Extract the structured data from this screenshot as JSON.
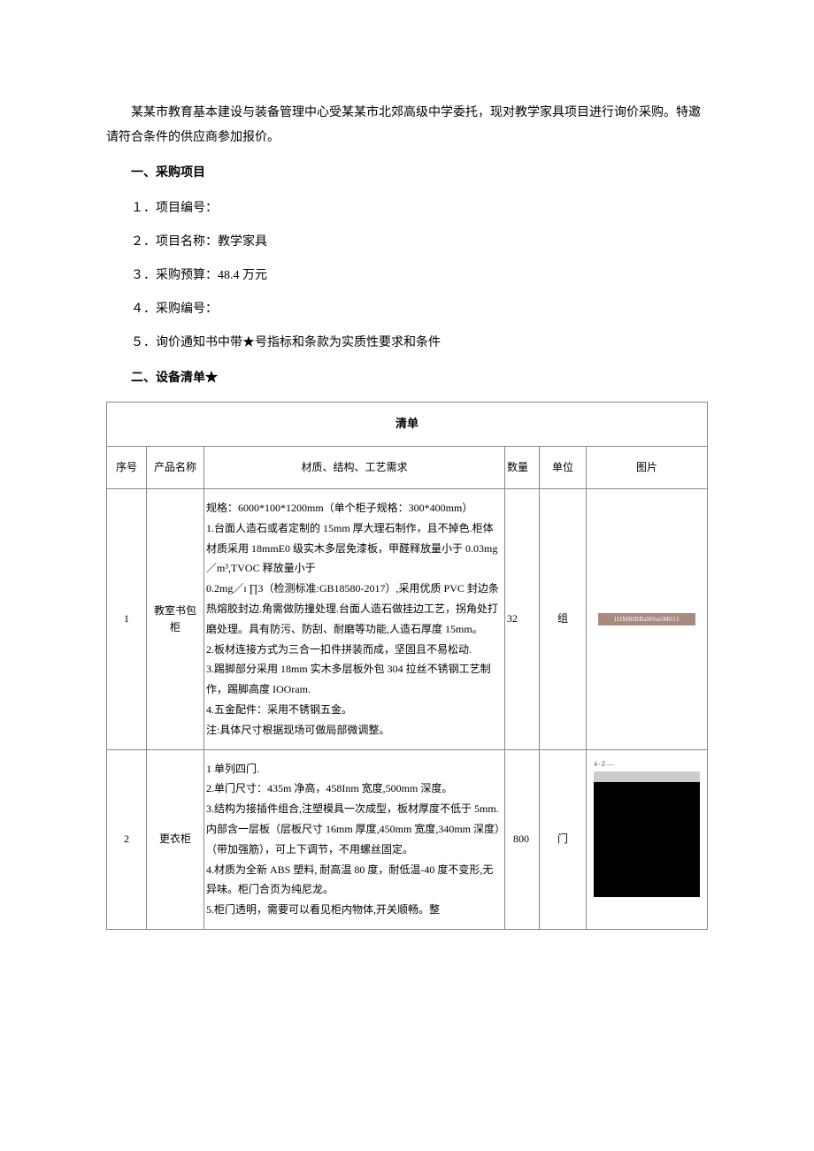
{
  "intro": "某某市教育基本建设与装备管理中心受某某市北郊高级中学委托，现对教学家具项目进行询价采购。特邀请符合条件的供应商参加报价。",
  "section1_title": "一、采购项目",
  "item1": "１．项目编号：",
  "item2": "２．项目名称：教学家具",
  "item3": "３．采购预算：48.4 万元",
  "item4": "４．采购编号：",
  "item5": "５．询价通知书中带★号指标和条款为实质性要求和条件",
  "section2_title": "二、设备清单★",
  "table": {
    "caption": "清单",
    "headers": {
      "seq": "序号",
      "name": "产品名称",
      "spec": "材质、结构、工艺需求",
      "qty": "数量",
      "unit": "单位",
      "img": "图片"
    },
    "rows": [
      {
        "seq": "1",
        "name": "教室书包柜",
        "spec": "规格：6000*100*1200mm（单个柜子规格：300*400mm）\n1.台面人造石或者定制的 15mm 厚大理石制作，且不掉色.柜体材质采用 18mmE0 级实木多层免漆板，甲醛释放量小于 0.03mg／m³,TVOC 释放量小于\n0.2mg／ɪ ∏3（检测标准:GB18580-2017）,采用优质 PVC 封边条热熔胶封边.角需做防撞处理.台面人造石做挂边工艺，拐角处打磨处理。具有防污、防刮、耐磨等功能,人造石厚度 15mm。\n2.板材连接方式为三合一扣件拼装而成，坚固且不易松动.\n3.踢脚部分采用 18mm 实木多层板外包 304 拉丝不锈钢工艺制作，踢脚高度 IOOram.\n4.五金配件：采用不锈钢五金。\n注:具体尺寸根据现场可做局部微调整。",
        "qty": "32",
        "unit": "组",
        "img_text": "I1IMBIBBaMSaiiMll11"
      },
      {
        "seq": "2",
        "name": "更衣柜",
        "spec": "1 单列四门.\n2.单门尺寸：435m 净高，458Inm 宽度,500mm 深度。\n3.结构为接插件组合,注塑模具一次成型，板材厚度不低于 5mm.内部含一层板（层板尺寸 16mm 厚度,450mm 宽度,340mm 深度）（带加强筋），可上下调节，不用螺丝固定。\n4.材质为全新 ABS 塑料, 耐高温 80 度，耐低温-40 度不变形,无异味。柜门合页为纯尼龙。\n5.柜门透明，需要可以看见柜内物体,开关顺畅。整",
        "qty": "800",
        "unit": "门",
        "img_label": "4-Z—"
      }
    ]
  }
}
